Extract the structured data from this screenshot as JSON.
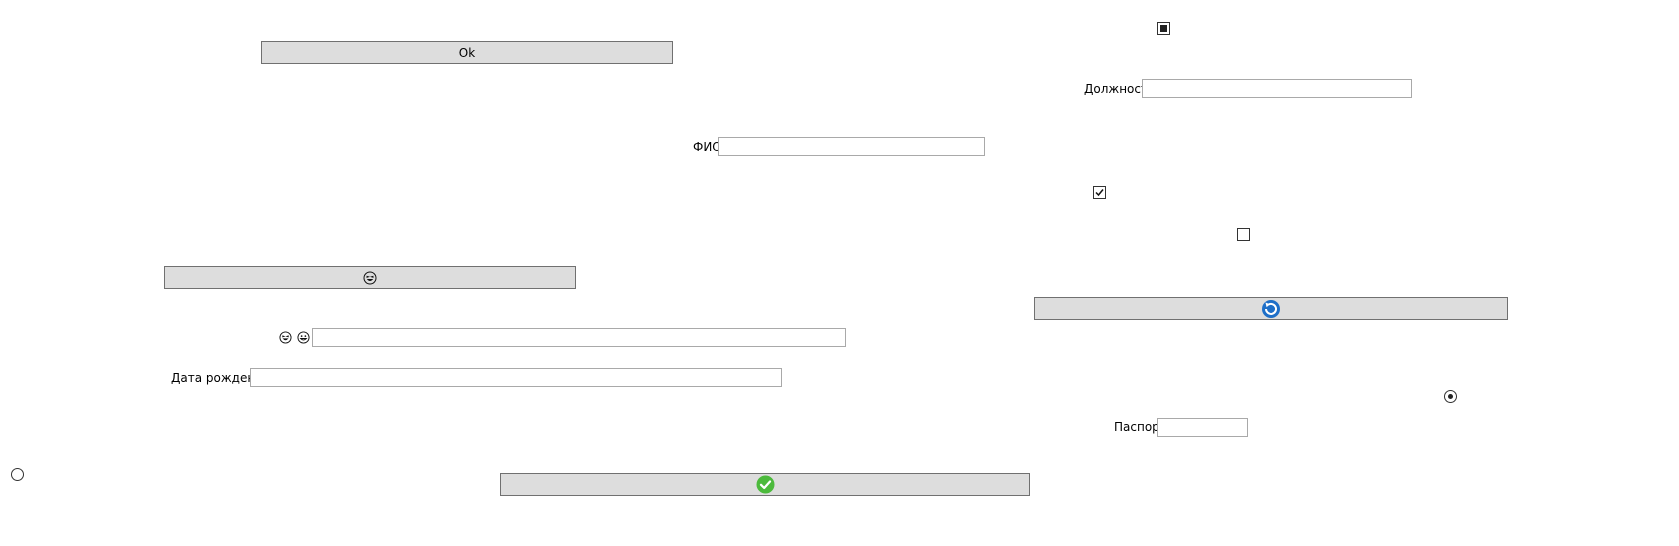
{
  "buttons": {
    "ok_label": "Ok"
  },
  "fields": {
    "dolzhnost": {
      "label": "Должность",
      "value": ""
    },
    "fio": {
      "label": "ФИО",
      "value": ""
    },
    "emoji_field": {
      "value": ""
    },
    "birth_date": {
      "label": "Дата рождения",
      "value": ""
    },
    "passport": {
      "label": "Паспорт",
      "value": ""
    }
  },
  "checkboxes": {
    "top_right": {
      "state": "indeterminate"
    },
    "middle": {
      "state": "checked"
    },
    "lower": {
      "state": "unchecked"
    }
  },
  "radios": {
    "bottom_left": {
      "selected": false
    },
    "right": {
      "selected": true
    }
  },
  "icons": {
    "emoji_button": "laughing-face-icon",
    "emoji_label_1": "laughing-face-icon",
    "emoji_label_2": "grinning-face-icon",
    "refresh_button": "refresh-icon",
    "confirm_button": "green-checkmark-icon"
  },
  "colors": {
    "button_bg": "#dddddd",
    "button_border": "#707070",
    "field_border": "#a9a9a9",
    "check_green": "#4cba3c",
    "refresh_blue": "#1e6fc8"
  }
}
